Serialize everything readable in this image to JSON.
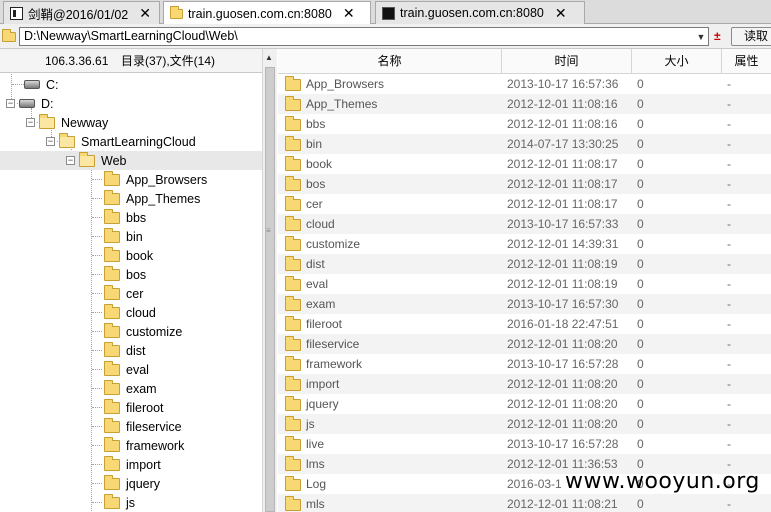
{
  "tabs": [
    {
      "label": "剑鞘@2016/01/02",
      "icon": "window-icon"
    },
    {
      "label": "train.guosen.com.cn:8080",
      "icon": "folder-icon"
    },
    {
      "label": "train.guosen.com.cn:8080",
      "icon": "terminal-icon"
    }
  ],
  "tab_close": "✕",
  "address": {
    "path": "D:\\Newway\\SmartLearningCloud\\Web\\",
    "plusminus": "±",
    "read_button": "读取"
  },
  "tree_header": {
    "ip": "106.3.36.61",
    "count": "目录(37),文件(14)"
  },
  "tree": {
    "drives": [
      "C:",
      "D:"
    ],
    "path": [
      "Newway",
      "SmartLearningCloud",
      "Web"
    ],
    "children": [
      "App_Browsers",
      "App_Themes",
      "bbs",
      "bin",
      "book",
      "bos",
      "cer",
      "cloud",
      "customize",
      "dist",
      "eval",
      "exam",
      "fileroot",
      "fileservice",
      "framework",
      "import",
      "jquery",
      "js"
    ]
  },
  "list_headers": {
    "name": "名称",
    "time": "时间",
    "size": "大小",
    "attr": "属性"
  },
  "rows": [
    {
      "name": "App_Browsers",
      "time": "2013-10-17 16:57:36",
      "size": "0",
      "attr": "-"
    },
    {
      "name": "App_Themes",
      "time": "2012-12-01 11:08:16",
      "size": "0",
      "attr": "-"
    },
    {
      "name": "bbs",
      "time": "2012-12-01 11:08:16",
      "size": "0",
      "attr": "-"
    },
    {
      "name": "bin",
      "time": "2014-07-17 13:30:25",
      "size": "0",
      "attr": "-"
    },
    {
      "name": "book",
      "time": "2012-12-01 11:08:17",
      "size": "0",
      "attr": "-"
    },
    {
      "name": "bos",
      "time": "2012-12-01 11:08:17",
      "size": "0",
      "attr": "-"
    },
    {
      "name": "cer",
      "time": "2012-12-01 11:08:17",
      "size": "0",
      "attr": "-"
    },
    {
      "name": "cloud",
      "time": "2013-10-17 16:57:33",
      "size": "0",
      "attr": "-"
    },
    {
      "name": "customize",
      "time": "2012-12-01 14:39:31",
      "size": "0",
      "attr": "-"
    },
    {
      "name": "dist",
      "time": "2012-12-01 11:08:19",
      "size": "0",
      "attr": "-"
    },
    {
      "name": "eval",
      "time": "2012-12-01 11:08:19",
      "size": "0",
      "attr": "-"
    },
    {
      "name": "exam",
      "time": "2013-10-17 16:57:30",
      "size": "0",
      "attr": "-"
    },
    {
      "name": "fileroot",
      "time": "2016-01-18 22:47:51",
      "size": "0",
      "attr": "-"
    },
    {
      "name": "fileservice",
      "time": "2012-12-01 11:08:20",
      "size": "0",
      "attr": "-"
    },
    {
      "name": "framework",
      "time": "2013-10-17 16:57:28",
      "size": "0",
      "attr": "-"
    },
    {
      "name": "import",
      "time": "2012-12-01 11:08:20",
      "size": "0",
      "attr": "-"
    },
    {
      "name": "jquery",
      "time": "2012-12-01 11:08:20",
      "size": "0",
      "attr": "-"
    },
    {
      "name": "js",
      "time": "2012-12-01 11:08:20",
      "size": "0",
      "attr": "-"
    },
    {
      "name": "live",
      "time": "2013-10-17 16:57:28",
      "size": "0",
      "attr": "-"
    },
    {
      "name": "lms",
      "time": "2012-12-01 11:36:53",
      "size": "0",
      "attr": "-"
    },
    {
      "name": "Log",
      "time": "2016-03-1",
      "size": "0",
      "attr": "-"
    },
    {
      "name": "mls",
      "time": "2012-12-01 11:08:21",
      "size": "0",
      "attr": "-"
    }
  ],
  "watermark": "www.wooyun.org"
}
